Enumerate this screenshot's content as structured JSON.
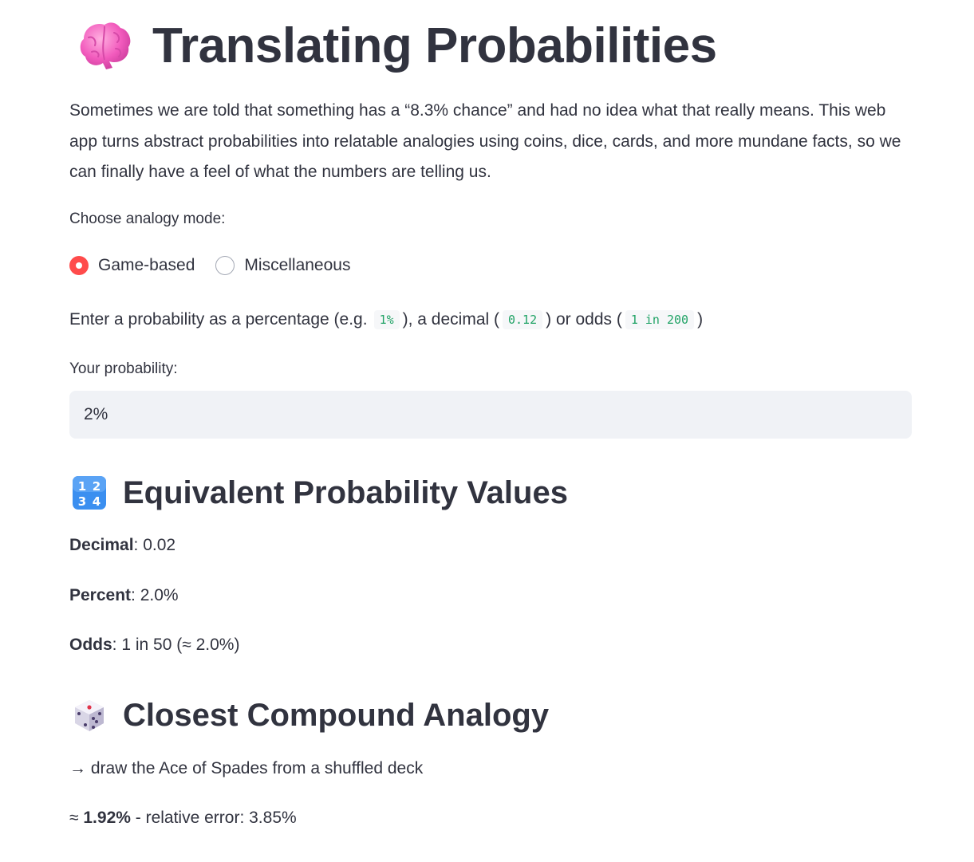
{
  "header": {
    "title": "Translating Probabilities",
    "icon": "brain-icon"
  },
  "intro": {
    "text": "Sometimes we are told that something has a “8.3% chance” and had no idea what that really means. This web app turns abstract probabilities into relatable analogies using coins, dice, cards, and more mundane facts, so we can finally have a feel of what the numbers are telling us."
  },
  "mode": {
    "label": "Choose analogy mode:",
    "options": [
      {
        "label": "Game-based",
        "selected": true
      },
      {
        "label": "Miscellaneous",
        "selected": false
      }
    ]
  },
  "instruction": {
    "prefix": "Enter a probability as a percentage (e.g.",
    "example_percent": "1%",
    "mid1": "), a decimal (",
    "example_decimal": "0.12",
    "mid2": ") or odds (",
    "example_odds": "1 in 200",
    "suffix": ")"
  },
  "probability_input": {
    "label": "Your probability:",
    "value": "2%"
  },
  "equivalent": {
    "title": "Equivalent Probability Values",
    "icon": "numbers-1234-icon",
    "decimal_label": "Decimal",
    "decimal_value": ": 0.02",
    "percent_label": "Percent",
    "percent_value": ": 2.0%",
    "odds_label": "Odds",
    "odds_value": ": 1 in 50 (≈ 2.0%)"
  },
  "analogy": {
    "title": "Closest Compound Analogy",
    "icon": "die-icon",
    "text": "→ draw the Ace of Spades from a shuffled deck",
    "approx_prefix": "≈ ",
    "approx_value": "1.92%",
    "error_text": " - relative error: 3.85%"
  },
  "colors": {
    "accent": "#ff4b4b",
    "text": "#31333f",
    "input_bg": "#f0f2f6",
    "code_text": "#21a366"
  }
}
